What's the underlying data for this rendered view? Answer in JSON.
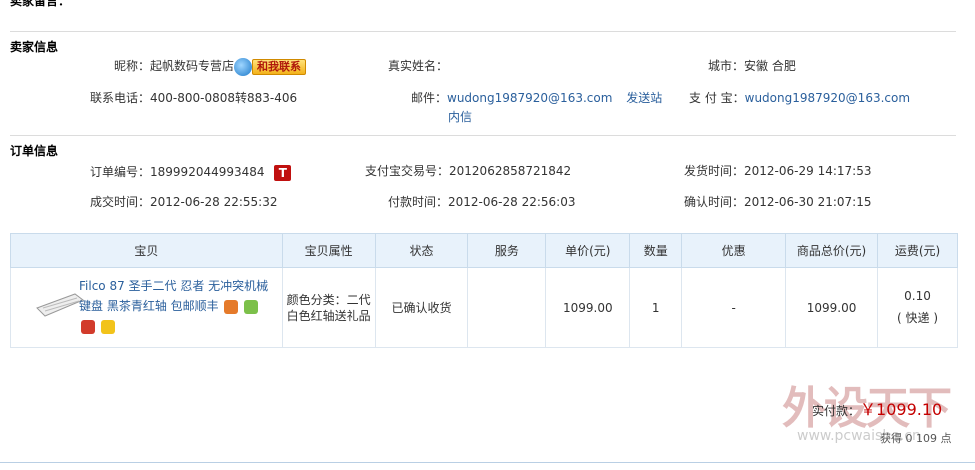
{
  "top_cut_label": "卖家留言：",
  "seller": {
    "section_title": "卖家信息",
    "nickname_label": "昵称：",
    "nickname": "起帆数码专营店",
    "contact_btn": "和我联系",
    "realname_label": "真实姓名：",
    "realname": "",
    "city_label": "城市：",
    "city": "安徽 合肥",
    "phone_label": "联系电话：",
    "phone": "400-800-0808转883-406",
    "email_label": "邮件：",
    "email": "wudong1987920@163.com",
    "send_msg": "发送站",
    "send_msg2": "内信",
    "alipay_label": "支 付 宝：",
    "alipay": "wudong1987920@163.com"
  },
  "order": {
    "section_title": "订单信息",
    "order_no_label": "订单编号：",
    "order_no": "189992044993484",
    "t_badge": "T",
    "alipay_trade_label": "支付宝交易号：",
    "alipay_trade": "2012062858721842",
    "ship_time_label": "发货时间：",
    "ship_time": "2012-06-29 14:17:53",
    "deal_time_label": "成交时间：",
    "deal_time": "2012-06-28 22:55:32",
    "pay_time_label": "付款时间：",
    "pay_time": "2012-06-28 22:56:03",
    "confirm_time_label": "确认时间：",
    "confirm_time": "2012-06-30 21:07:15"
  },
  "table": {
    "headers": [
      "宝贝",
      "宝贝属性",
      "状态",
      "服务",
      "单价(元)",
      "数量",
      "优惠",
      "商品总价(元)",
      "运费(元)"
    ],
    "row": {
      "title": "Filco 87 圣手二代 忍者 无冲突机械键盘 黑茶青红轴 包邮顺丰",
      "attr": "颜色分类：二代白色红轴送礼品",
      "status": "已确认收货",
      "service": "",
      "price": "1099.00",
      "qty": "1",
      "discount": "-",
      "total": "1099.00",
      "shipping": "0.10",
      "shipping_method": "( 快递 )"
    }
  },
  "summary": {
    "paid_label": "实付款：",
    "currency": "￥",
    "paid_amount": "1099.10",
    "points": "获得 0 109 点"
  },
  "watermark": {
    "brand": "外设天下",
    "url": "www.pcwaishe.cn"
  },
  "colors": {
    "link": "#2a5f9c",
    "header_bg": "#e8f2fb",
    "price_red": "#c40000"
  }
}
